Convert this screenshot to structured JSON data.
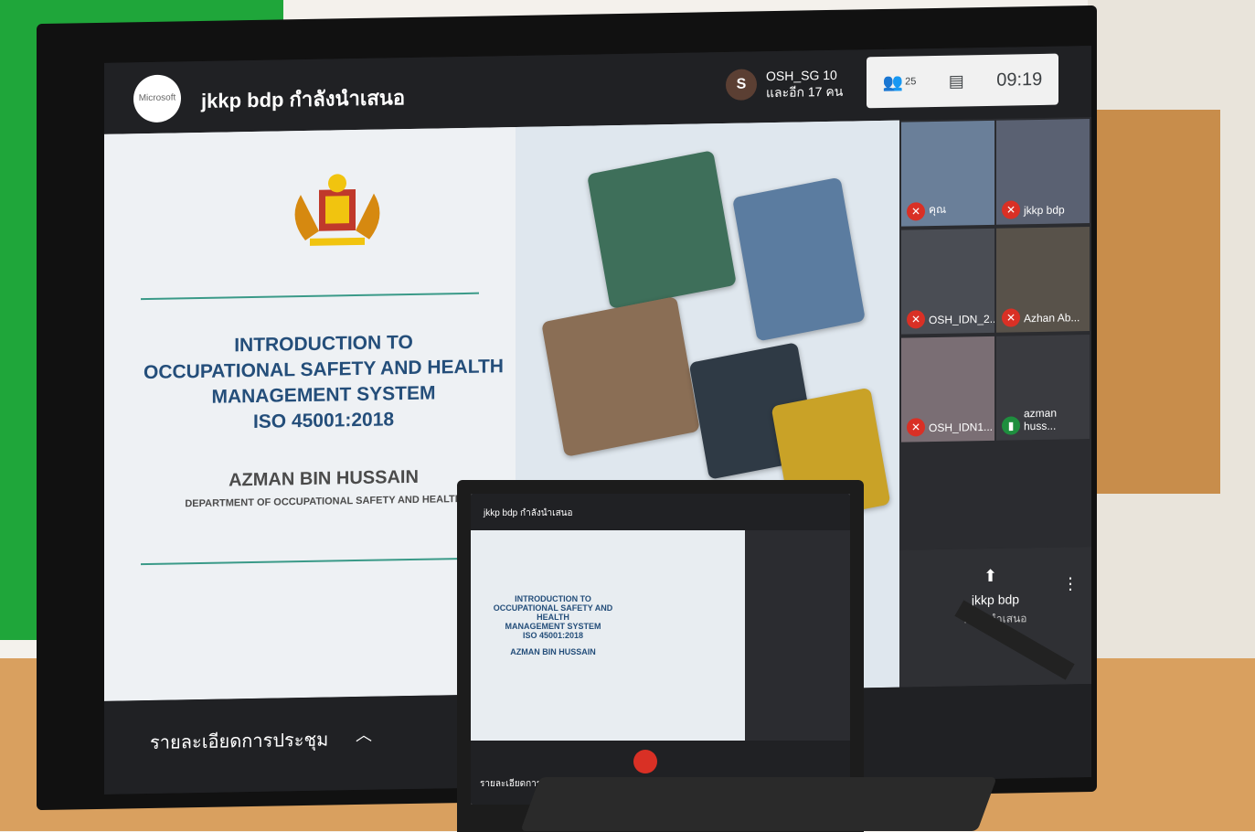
{
  "monitor": {
    "presenter_title": "jkkp bdp กำลังนำเสนอ",
    "ms_logo_text": "Microsoft",
    "participants": {
      "name": "OSH_SG 10",
      "more": "และอีก 17 คน",
      "avatar_letter": "S"
    },
    "controls": {
      "people_count": "25",
      "time": "09:19"
    },
    "self_tile_label": "คุณ",
    "slide": {
      "title_lines": [
        "INTRODUCTION TO",
        "OCCUPATIONAL SAFETY AND HEALTH",
        "MANAGEMENT SYSTEM",
        "ISO 45001:2018"
      ],
      "presenter": "AZMAN BIN HUSSAIN",
      "department": "DEPARTMENT OF OCCUPATIONAL SAFETY AND HEALTH"
    },
    "grid_tiles": [
      {
        "name": "คุณ"
      },
      {
        "name": "jkkp bdp"
      },
      {
        "name": "OSH_IDN_2..."
      },
      {
        "name": "Azhan Ab..."
      },
      {
        "name": "OSH_IDN1..."
      },
      {
        "name": "azman huss..."
      }
    ],
    "presenting_panel": {
      "name": "jkkp bdp",
      "status": "กำลังนำเสนอ"
    },
    "meeting_details": "รายละเอียดการประชุม"
  },
  "laptop": {
    "title": "jkkp bdp กำลังนำเสนอ",
    "slide_text": [
      "INTRODUCTION TO",
      "OCCUPATIONAL SAFETY AND HEALTH",
      "MANAGEMENT SYSTEM",
      "ISO 45001:2018",
      "AZMAN BIN HUSSAIN"
    ],
    "meeting_details": "รายละเอียดการประชุม"
  }
}
